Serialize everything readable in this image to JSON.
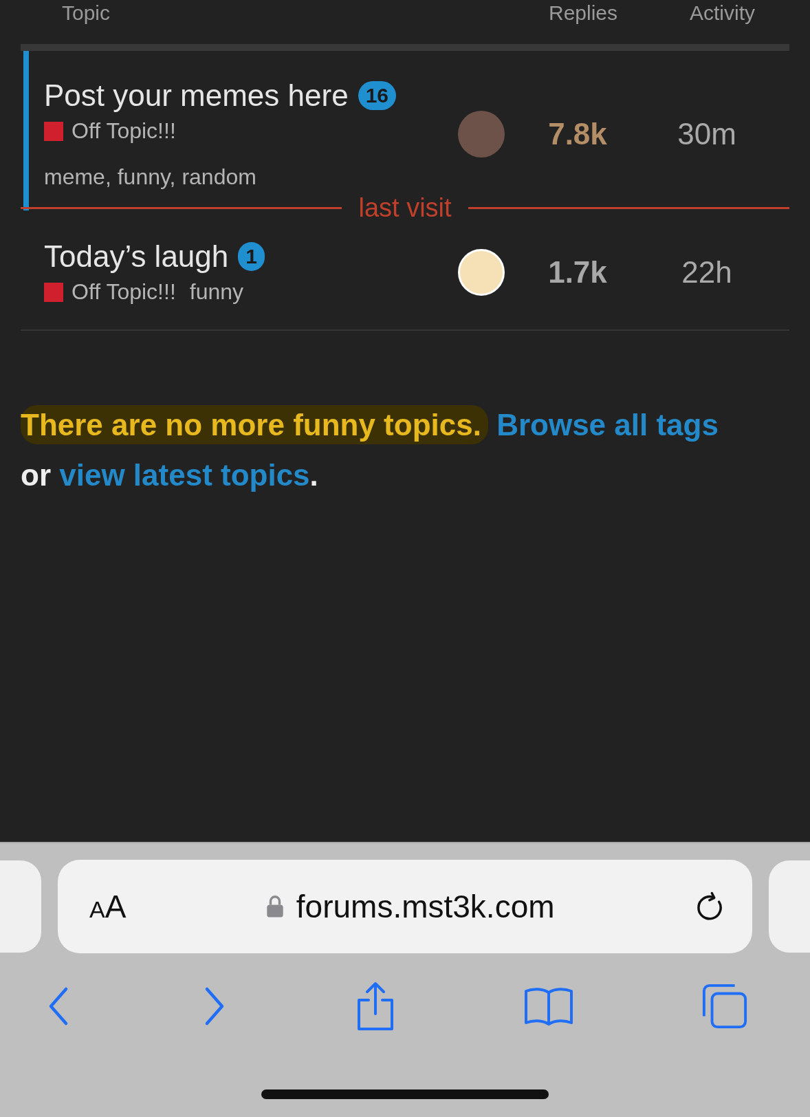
{
  "table": {
    "columns": [
      {
        "label": "Topic"
      },
      {
        "label": "Replies"
      },
      {
        "label": "Activity"
      }
    ],
    "rows": [
      {
        "title": "Post your memes here",
        "unread": "16",
        "category": {
          "name": "Off Topic!!!",
          "color": "#d0202e"
        },
        "tags": "meme, funny, random",
        "replies": "7.8k",
        "hot": true,
        "activity": "30m",
        "highlighted": true,
        "inline_tags": false,
        "last_visit_below": true
      },
      {
        "title": "Today’s laugh",
        "unread": "1",
        "category": {
          "name": "Off Topic!!!",
          "color": "#d0202e"
        },
        "tags": "funny",
        "replies": "1.7k",
        "hot": false,
        "activity": "22h",
        "highlighted": false,
        "inline_tags": true,
        "last_visit_below": false
      }
    ],
    "last_visit": {
      "label": "last visit"
    }
  },
  "footer": {
    "message": "There are no more funny topics.",
    "highlighted": true,
    "browse_link": "Browse all tags",
    "connector": "or",
    "latest_link": "view latest topics",
    "end": "."
  },
  "browser": {
    "reader_label": "AA",
    "url": "forums.mst3k.com"
  }
}
